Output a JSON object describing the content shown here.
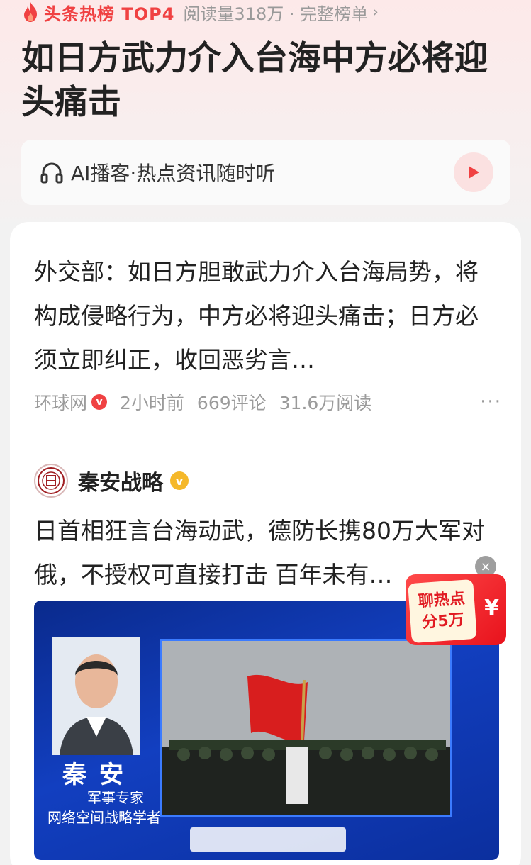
{
  "rank_bar": {
    "label": "头条热榜 TOP4",
    "meta": "阅读量318万 · 完整榜单",
    "chevron": "›"
  },
  "headline": "如日方武力介入台海中方必将迎头痛击",
  "podcast": {
    "text": "AI播客·热点资讯随时听",
    "icon": "headphone-icon",
    "play_icon": "play-icon"
  },
  "news": {
    "title": "外交部：如日方胆敢武力介入台海局势，将构成侵略行为，中方必将迎头痛击；日方必须立即纠正，收回恶劣言…",
    "source": "环球网",
    "verified_mark": "v",
    "time": "2小时前",
    "comments": "669评论",
    "reads": "31.6万阅读",
    "more": "···"
  },
  "post": {
    "author": "秦安战略",
    "badge_mark": "v",
    "title": "日首相狂言台海动武，德防长携80万大军对俄，不授权可直接打击 百年未有…",
    "video": {
      "presenter_name": "秦安",
      "presenter_role": "军事专家",
      "presenter_title": "网络空间战略学者"
    }
  },
  "float_promo": {
    "line1": "聊热点",
    "line2": "分5万",
    "yen": "¥",
    "close": "×"
  },
  "colors": {
    "accent": "#f04142",
    "gold": "#f5b82a",
    "video_blue": "#123fc0"
  }
}
